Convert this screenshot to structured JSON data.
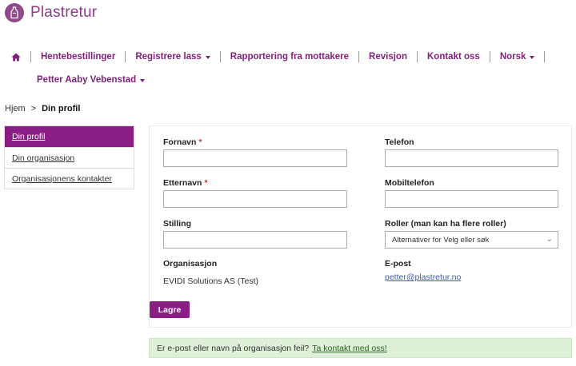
{
  "brand": {
    "name": "Plastretur",
    "accent": "#8b1e85",
    "notice_bg": "#dff0d8"
  },
  "nav": {
    "home_icon": "home-icon",
    "items": [
      {
        "label": "Hentebestillinger",
        "dropdown": false
      },
      {
        "label": "Registrere lass",
        "dropdown": true
      },
      {
        "label": "Rapportering fra mottakere",
        "dropdown": false
      },
      {
        "label": "Revisjon",
        "dropdown": false
      },
      {
        "label": "Kontakt oss",
        "dropdown": false
      },
      {
        "label": "Norsk",
        "dropdown": true
      }
    ],
    "user": "Petter Aaby Vebenstad"
  },
  "breadcrumb": {
    "home": "Hjem",
    "separator": ">",
    "current": "Din profil"
  },
  "sidebar": {
    "items": [
      {
        "label": "Din profil",
        "active": true
      },
      {
        "label": "Din organisasjon",
        "active": false
      },
      {
        "label": "Organisasjonens kontakter",
        "active": false
      }
    ]
  },
  "form": {
    "first_name": {
      "label": "Fornavn",
      "required_mark": "*",
      "value": ""
    },
    "last_name": {
      "label": "Etternavn",
      "required_mark": "*",
      "value": ""
    },
    "position": {
      "label": "Stilling",
      "value": ""
    },
    "phone": {
      "label": "Telefon",
      "value": ""
    },
    "mobile": {
      "label": "Mobiltelefon",
      "value": ""
    },
    "roles": {
      "label": "Roller (man kan ha flere roller)",
      "placeholder": "Alternativer for Velg eller søk"
    },
    "organisation": {
      "label": "Organisasjon",
      "value": "EVIDI Solutions AS (Test)"
    },
    "email": {
      "label": "E-post",
      "value": "petter@plastretur.no"
    },
    "save_label": "Lagre"
  },
  "notice": {
    "text": "Er e-post eller navn på organisasjon feil?",
    "link": "Ta kontakt med oss!"
  }
}
